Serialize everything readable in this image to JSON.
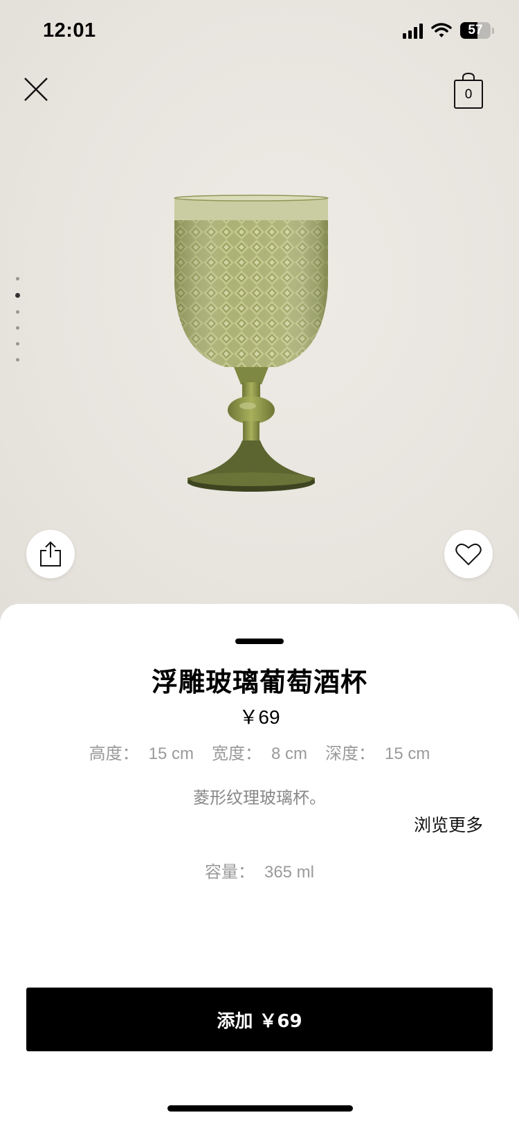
{
  "status_bar": {
    "time": "12:01",
    "battery": "57",
    "battery_level": 0.57
  },
  "header": {
    "cart_count": "0",
    "icons": {
      "close": "close-icon",
      "cart": "shopping-bag-icon"
    }
  },
  "gallery": {
    "image_count": 6,
    "active_index": 1,
    "image": "green-embossed-wine-glass"
  },
  "actions": {
    "share_icon": "share-icon",
    "favorite_icon": "heart-icon"
  },
  "product": {
    "title": "浮雕玻璃葡萄酒杯",
    "price": "￥69",
    "dimensions": [
      {
        "label": "高度：",
        "value": "15 cm"
      },
      {
        "label": "宽度：",
        "value": "8 cm"
      },
      {
        "label": "深度：",
        "value": "15 cm"
      }
    ],
    "description": "菱形纹理玻璃杯。",
    "more_link": "浏览更多",
    "capacity": {
      "label": "容量：",
      "value": "365 ml"
    }
  },
  "cta": {
    "label": "添加 ￥69"
  },
  "colors": {
    "accent": "#000000",
    "glass": "#9aa45a"
  }
}
